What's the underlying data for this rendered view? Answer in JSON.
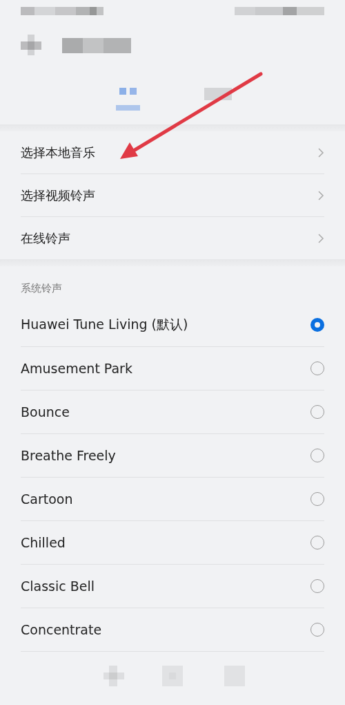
{
  "menu": [
    {
      "label": "选择本地音乐"
    },
    {
      "label": "选择视频铃声"
    },
    {
      "label": "在线铃声"
    }
  ],
  "section_title": "系统铃声",
  "ringtones": [
    {
      "name": "Huawei Tune Living (默认)",
      "selected": true
    },
    {
      "name": "Amusement Park",
      "selected": false
    },
    {
      "name": "Bounce",
      "selected": false
    },
    {
      "name": "Breathe Freely",
      "selected": false
    },
    {
      "name": "Cartoon",
      "selected": false
    },
    {
      "name": "Chilled",
      "selected": false
    },
    {
      "name": "Classic Bell",
      "selected": false
    },
    {
      "name": "Concentrate",
      "selected": false
    }
  ]
}
